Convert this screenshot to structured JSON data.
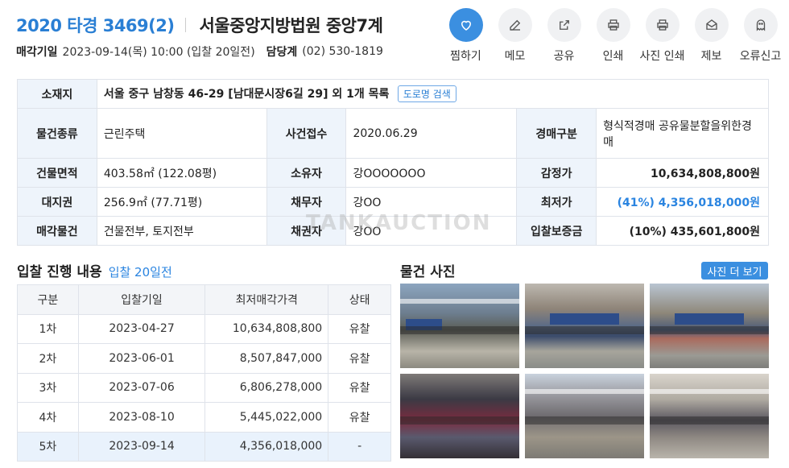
{
  "header": {
    "case_no": "2020 타경 3469(2)",
    "court": "서울중앙지방법원 중앙7계",
    "sale_date_label": "매각기일",
    "sale_date_value": "2023-09-14(목) 10:00 (입찰 20일전)",
    "dept_label": "담당계",
    "dept_value": "(02) 530-1819"
  },
  "actions": [
    {
      "label": "찜하기",
      "icon": "heart-icon"
    },
    {
      "label": "메모",
      "icon": "pencil-icon"
    },
    {
      "label": "공유",
      "icon": "share-icon"
    },
    {
      "label": "인쇄",
      "icon": "printer-icon"
    },
    {
      "label": "사진 인쇄",
      "icon": "printer-icon"
    },
    {
      "label": "제보",
      "icon": "envelope-icon"
    },
    {
      "label": "오류신고",
      "icon": "ghost-icon"
    }
  ],
  "info": {
    "location_label": "소재지",
    "location_value": "서울 중구 남창동 46-29 [남대문시장6길 29] 외 1개 목록",
    "road_btn": "도로명 검색",
    "type_label": "물건종류",
    "type_value": "근린주택",
    "received_label": "사건접수",
    "received_value": "2020.06.29",
    "auction_type_label": "경매구분",
    "auction_type_value": "형식적경매 공유물분할을위한경매",
    "building_area_label": "건물면적",
    "building_area_value": "403.58㎡ (122.08평)",
    "owner_label": "소유자",
    "owner_value": "강OOOOOOO",
    "appraisal_label": "감정가",
    "appraisal_value": "10,634,808,800원",
    "land_label": "대지권",
    "land_value": "256.9㎡ (77.71평)",
    "debtor_label": "채무자",
    "debtor_value": "강OO",
    "min_price_label": "최저가",
    "min_price_value": "(41%) 4,356,018,000원",
    "sale_item_label": "매각물건",
    "sale_item_value": "건물전부, 토지전부",
    "creditor_label": "채권자",
    "creditor_value": "강OO",
    "deposit_label": "입찰보증금",
    "deposit_value": "(10%) 435,601,800원"
  },
  "bid_section": {
    "title": "입찰 진행 내용",
    "subtitle": "입찰 20일전",
    "columns": [
      "구분",
      "입찰기일",
      "최저매각가격",
      "상태"
    ],
    "rows": [
      [
        "1차",
        "2023-04-27",
        "10,634,808,800",
        "유찰"
      ],
      [
        "2차",
        "2023-06-01",
        "8,507,847,000",
        "유찰"
      ],
      [
        "3차",
        "2023-07-06",
        "6,806,278,000",
        "유찰"
      ],
      [
        "4차",
        "2023-08-10",
        "5,445,022,000",
        "유찰"
      ],
      [
        "5차",
        "2023-09-14",
        "4,356,018,000",
        "-"
      ]
    ]
  },
  "photo_section": {
    "title": "물건 사진",
    "more_btn": "사진 더 보기"
  },
  "watermark": "TANKAUCTION",
  "colors": {
    "accent": "#3b8fe0",
    "case_no": "#2a7fd4",
    "header_cell": "#eef4fb"
  }
}
